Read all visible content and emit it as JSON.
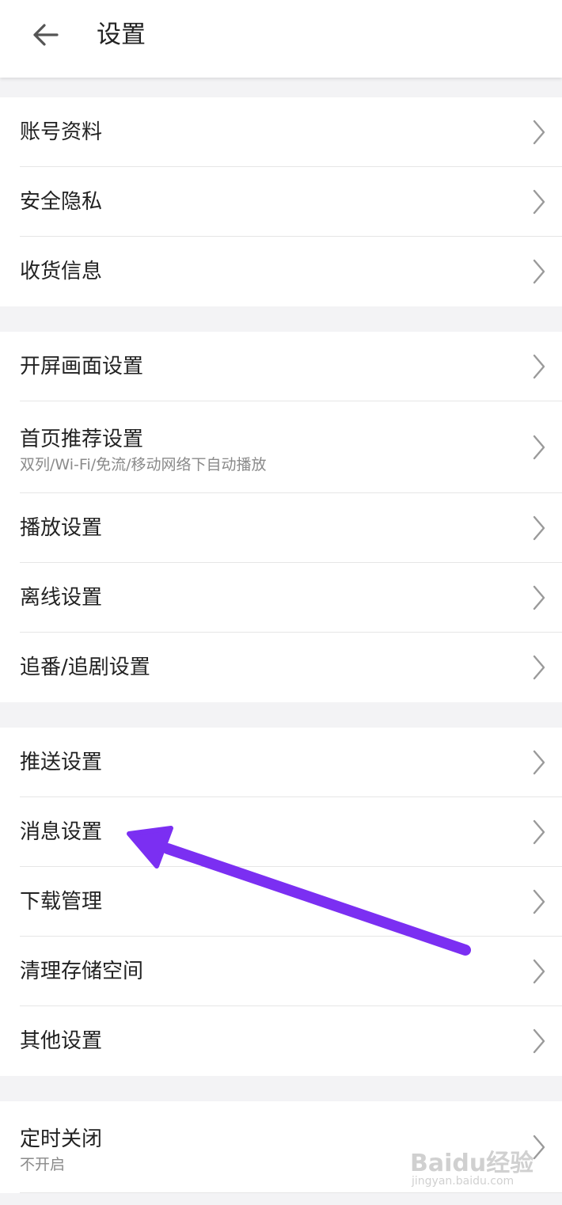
{
  "header": {
    "title": "设置",
    "back_icon": "arrow-left-icon"
  },
  "groups": [
    {
      "items": [
        {
          "label": "账号资料"
        },
        {
          "label": "安全隐私"
        },
        {
          "label": "收货信息"
        }
      ]
    },
    {
      "items": [
        {
          "label": "开屏画面设置"
        },
        {
          "label": "首页推荐设置",
          "sub": "双列/Wi-Fi/免流/移动网络下自动播放"
        },
        {
          "label": "播放设置"
        },
        {
          "label": "离线设置"
        },
        {
          "label": "追番/追剧设置"
        }
      ]
    },
    {
      "items": [
        {
          "label": "推送设置"
        },
        {
          "label": "消息设置"
        },
        {
          "label": "下载管理"
        },
        {
          "label": "清理存储空间"
        },
        {
          "label": "其他设置"
        }
      ]
    },
    {
      "items": [
        {
          "label": "定时关闭",
          "sub": "不开启"
        }
      ]
    }
  ],
  "annotation": {
    "arrow_color": "#7b2ff2",
    "arrow_icon": "annotation-arrow-icon"
  },
  "watermark": {
    "main": "Baidu经验",
    "sub": "jingyan.baidu.com"
  },
  "colors": {
    "background": "#f3f3f5",
    "divider": "#e6e6e6",
    "text": "#222222",
    "subtext": "#8a8a8a"
  }
}
